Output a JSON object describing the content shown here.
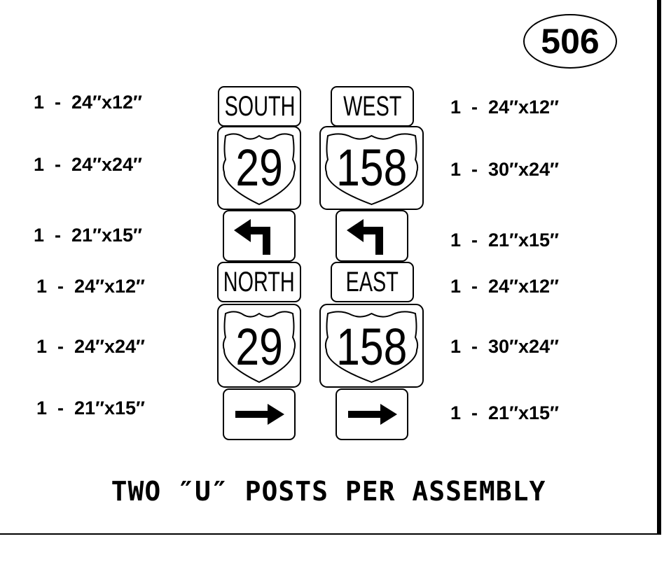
{
  "assembly_number": "506",
  "left_sizes": [
    "1  -  24″x12″",
    "1  -  24″x24″",
    "1  -  21″x15″",
    "1  -  24″x12″",
    "1  -  24″x24″",
    "1  -  21″x15″"
  ],
  "right_sizes": [
    "1  -  24″x12″",
    "1  -  30″x24″",
    "1  -  21″x15″",
    "1  -  24″x12″",
    "1  -  30″x24″",
    "1  -  21″x15″"
  ],
  "left_column": {
    "top": {
      "direction": "SOUTH",
      "route": "29",
      "arrow": "left-turn-arrow"
    },
    "bottom": {
      "direction": "NORTH",
      "route": "29",
      "arrow": "right-arrow"
    }
  },
  "right_column": {
    "top": {
      "direction": "WEST",
      "route": "158",
      "arrow": "left-turn-arrow"
    },
    "bottom": {
      "direction": "EAST",
      "route": "158",
      "arrow": "right-arrow"
    }
  },
  "footer_note": "TWO  ″U″  POSTS  PER  ASSEMBLY"
}
